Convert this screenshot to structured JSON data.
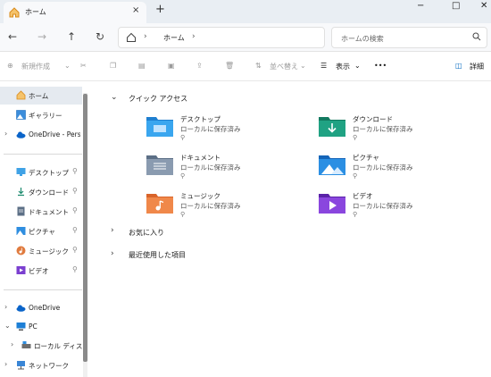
{
  "tab": {
    "title": "ホーム",
    "close": "×",
    "add": "+"
  },
  "window": {
    "minimize": "−",
    "maximize": "□",
    "close": "✕"
  },
  "address": {
    "crumb": "ホーム",
    "chevron": "›"
  },
  "search": {
    "placeholder": "ホームの検索"
  },
  "commands": {
    "new": "新規作成",
    "sort": "並べ替え",
    "view": "表示",
    "more": "•••",
    "details": "詳細"
  },
  "sidebar": {
    "items": [
      {
        "label": "ホーム"
      },
      {
        "label": "ギャラリー"
      },
      {
        "label": "OneDrive - Personal"
      },
      {
        "label": "デスクトップ"
      },
      {
        "label": "ダウンロード"
      },
      {
        "label": "ドキュメント"
      },
      {
        "label": "ピクチャ"
      },
      {
        "label": "ミュージック"
      },
      {
        "label": "ビデオ"
      },
      {
        "label": "OneDrive"
      },
      {
        "label": "PC"
      },
      {
        "label": "ローカル ディスク"
      },
      {
        "label": "ネットワーク"
      }
    ]
  },
  "main": {
    "quick_access": "クイック アクセス",
    "favorites": "お気に入り",
    "recent": "最近使用した項目",
    "folders": [
      {
        "name": "デスクトップ",
        "status": "ローカルに保存済み"
      },
      {
        "name": "ダウンロード",
        "status": "ローカルに保存済み"
      },
      {
        "name": "ドキュメント",
        "status": "ローカルに保存済み"
      },
      {
        "name": "ピクチャ",
        "status": "ローカルに保存済み"
      },
      {
        "name": "ミュージック",
        "status": "ローカルに保存済み"
      },
      {
        "name": "ビデオ",
        "status": "ローカルに保存済み"
      }
    ]
  },
  "colors": {
    "accent": "#0067c0",
    "selected": "#e5eaf0",
    "titlebar": "#e9eef3"
  }
}
